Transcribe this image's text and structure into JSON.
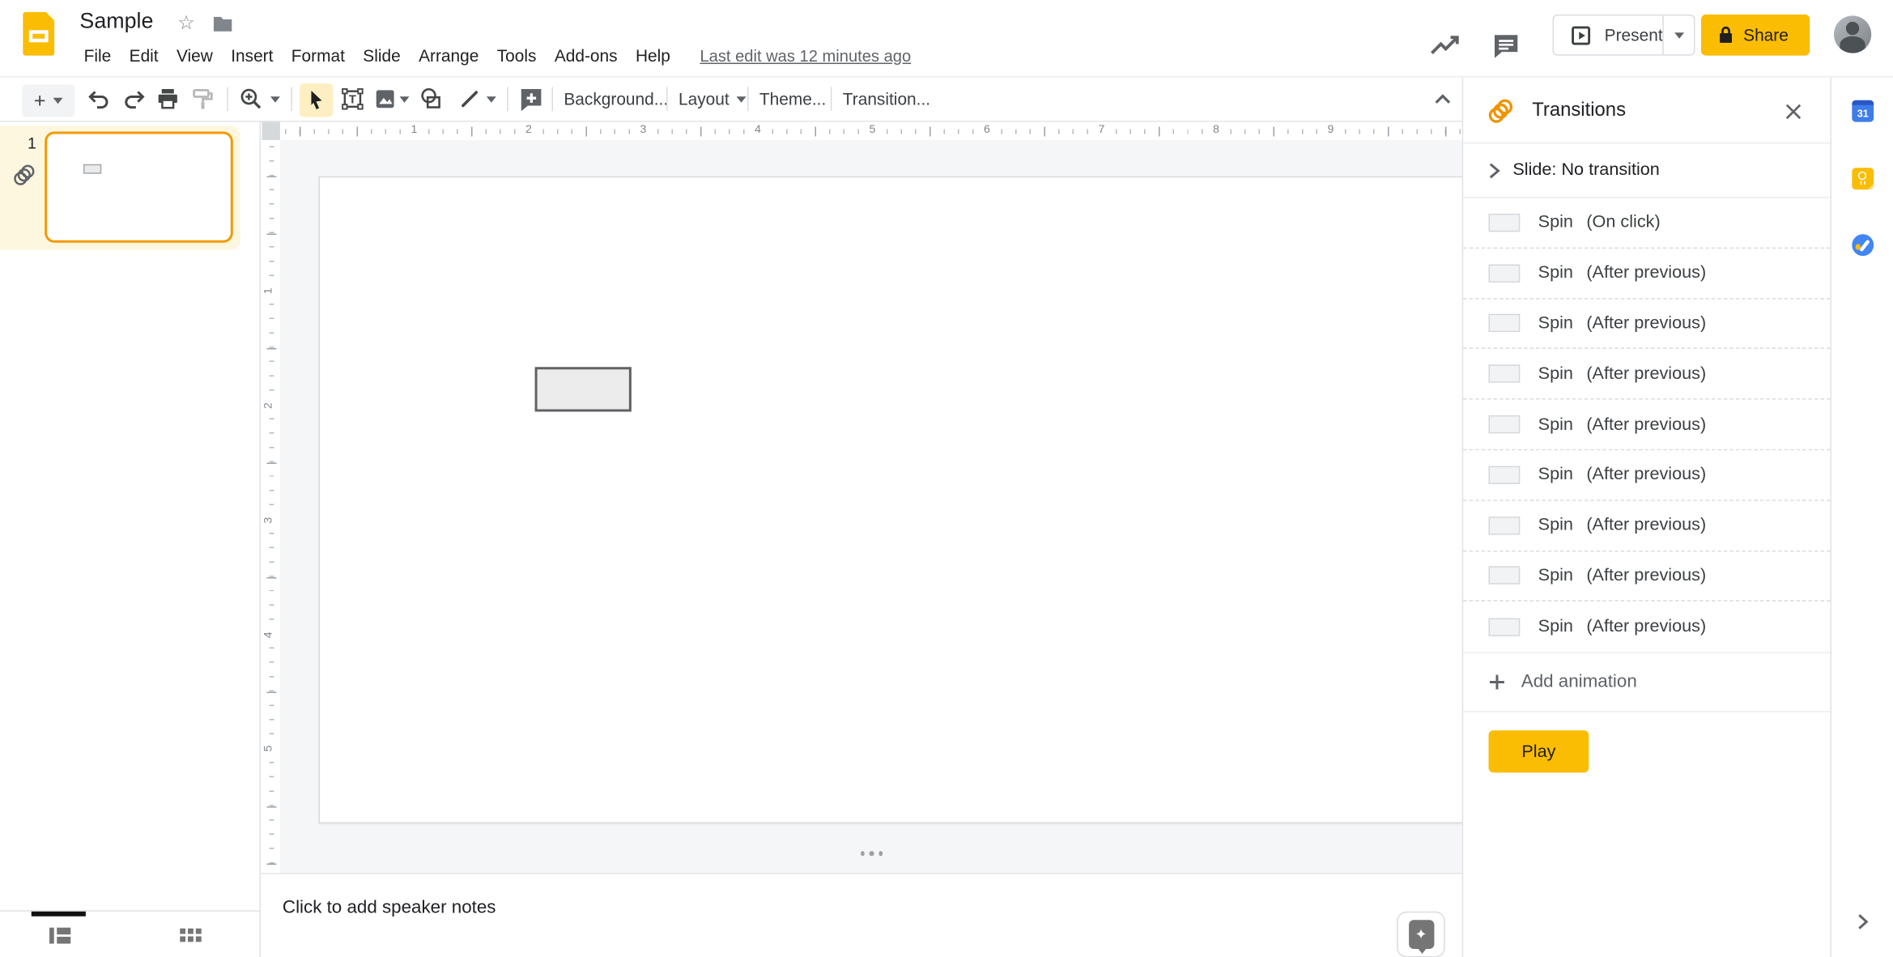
{
  "topbar": {
    "title": "Sample",
    "menus": [
      "File",
      "Edit",
      "View",
      "Insert",
      "Format",
      "Slide",
      "Arrange",
      "Tools",
      "Add-ons",
      "Help"
    ],
    "last_edit": "Last edit was 12 minutes ago",
    "present_label": "Present",
    "share_label": "Share"
  },
  "toolbar": {
    "background_label": "Background...",
    "layout_label": "Layout",
    "theme_label": "Theme...",
    "transition_label": "Transition..."
  },
  "filmstrip": {
    "slide_number": "1"
  },
  "rulers": {
    "horizontal": [
      "1",
      "2",
      "3",
      "4",
      "5",
      "6",
      "7",
      "8",
      "9"
    ],
    "vertical": [
      "1",
      "2",
      "3",
      "4",
      "5"
    ]
  },
  "notes": {
    "placeholder": "Click to add speaker notes"
  },
  "transitions_panel": {
    "title": "Transitions",
    "slide_transition": "Slide: No transition",
    "animations": [
      {
        "effect": "Spin",
        "trigger": "(On click)"
      },
      {
        "effect": "Spin",
        "trigger": "(After previous)"
      },
      {
        "effect": "Spin",
        "trigger": "(After previous)"
      },
      {
        "effect": "Spin",
        "trigger": "(After previous)"
      },
      {
        "effect": "Spin",
        "trigger": "(After previous)"
      },
      {
        "effect": "Spin",
        "trigger": "(After previous)"
      },
      {
        "effect": "Spin",
        "trigger": "(After previous)"
      },
      {
        "effect": "Spin",
        "trigger": "(After previous)"
      },
      {
        "effect": "Spin",
        "trigger": "(After previous)"
      }
    ],
    "add_animation_label": "Add animation",
    "play_label": "Play"
  },
  "colors": {
    "accent_yellow": "#fbbc04",
    "selected_tool_bg": "#feefc3",
    "selected_thumb_border": "#f29900",
    "selected_row_bg": "#fef7e0",
    "logo_yellow": "#fbbc04"
  }
}
